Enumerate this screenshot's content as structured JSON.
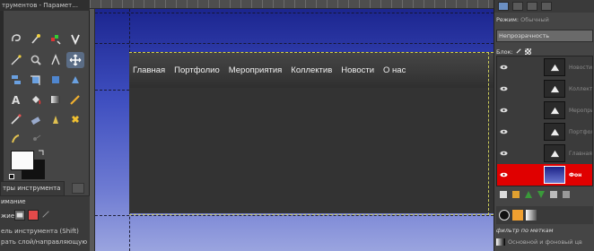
{
  "toolbox": {
    "title": "трументов - Парамет...",
    "tool_options_tab": "тры инструмента",
    "options_heading": "имание",
    "mode_label": "жие",
    "options_line1": "ель инструмента  (Shift)",
    "options_line2": "рать слой/направляющую"
  },
  "canvas": {
    "nav_items": [
      "Главная",
      "Портфолио",
      "Мероприятия",
      "Коллектив",
      "Новости",
      "О нас"
    ],
    "colors": {
      "header": "#3b3b3b",
      "content": "#333333",
      "background_top": "#18218a",
      "background_bottom": "#9aa4df"
    }
  },
  "layers_panel": {
    "mode_label": "Режим:",
    "mode_value": "Обычный",
    "opacity_label": "Непрозрачность",
    "lock_label": "Блок:",
    "layers": [
      {
        "name": "Новости",
        "visible": true,
        "selected": false
      },
      {
        "name": "Коллектив",
        "visible": true,
        "selected": false
      },
      {
        "name": "Мероприятия",
        "visible": true,
        "selected": false
      },
      {
        "name": "Портфолио",
        "visible": true,
        "selected": false
      },
      {
        "name": "Главная",
        "visible": true,
        "selected": false
      },
      {
        "name": "Фон",
        "visible": true,
        "selected": true
      }
    ],
    "filter_label": "фильтр по меткам",
    "filter_item": "Основной и фоновый цв"
  }
}
